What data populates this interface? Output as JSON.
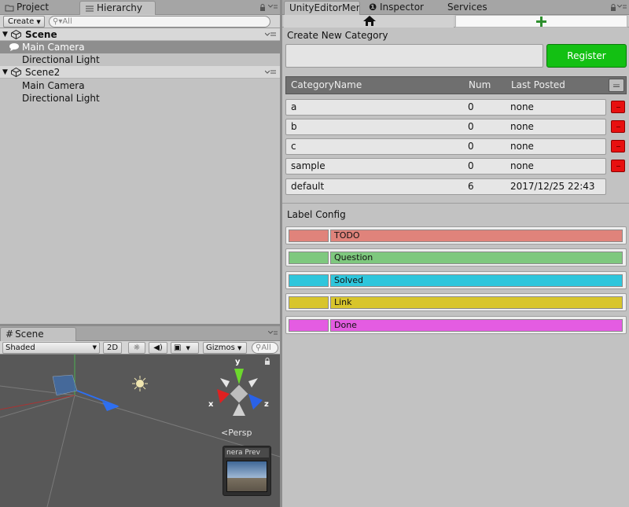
{
  "hierarchy": {
    "tabs": {
      "project": "Project",
      "hierarchy": "Hierarchy"
    },
    "create_label": "Create",
    "search_placeholder": "All",
    "rows": [
      {
        "label": "Scene",
        "kind": "scene"
      },
      {
        "label": "Main Camera",
        "kind": "child",
        "selected": true
      },
      {
        "label": "Directional Light",
        "kind": "child"
      },
      {
        "label": "Scene2",
        "kind": "scene"
      },
      {
        "label": "Main Camera",
        "kind": "child"
      },
      {
        "label": "Directional Light",
        "kind": "child"
      }
    ]
  },
  "scene_view": {
    "tab": "Scene",
    "shading": "Shaded",
    "mode_2d": "2D",
    "gizmos": "Gizmos",
    "search_placeholder": "All",
    "persp_label": "Persp",
    "camera_preview": "nera Prev",
    "axis_y": "y",
    "axis_x": "x",
    "axis_z": "z"
  },
  "right_panel": {
    "tabs": {
      "memo": "UnityEditorMem",
      "inspector": "Inspector",
      "services": "Services"
    },
    "create_category_label": "Create New Category",
    "category_input_value": "",
    "register_label": "Register",
    "table": {
      "headers": {
        "name": "CategoryName",
        "num": "Num",
        "last": "Last Posted"
      },
      "rows": [
        {
          "name": "a",
          "num": "0",
          "last": "none",
          "deletable": true
        },
        {
          "name": "b",
          "num": "0",
          "last": "none",
          "deletable": true
        },
        {
          "name": "c",
          "num": "0",
          "last": "none",
          "deletable": true
        },
        {
          "name": "sample",
          "num": "0",
          "last": "none",
          "deletable": true
        },
        {
          "name": "default",
          "num": "6",
          "last": "2017/12/25 22:43",
          "deletable": false
        }
      ]
    },
    "label_config_title": "Label Config",
    "labels": [
      {
        "name": "TODO",
        "color": "#e0837b"
      },
      {
        "name": "Question",
        "color": "#7ec87e"
      },
      {
        "name": "Solved",
        "color": "#2ec6dc"
      },
      {
        "name": "Link",
        "color": "#d8c52c"
      },
      {
        "name": "Done",
        "color": "#e45ce2"
      }
    ]
  },
  "colors": {
    "register_green": "#13c013",
    "delete_red": "#e80f0f",
    "selected_row": "#8e8e8e"
  }
}
